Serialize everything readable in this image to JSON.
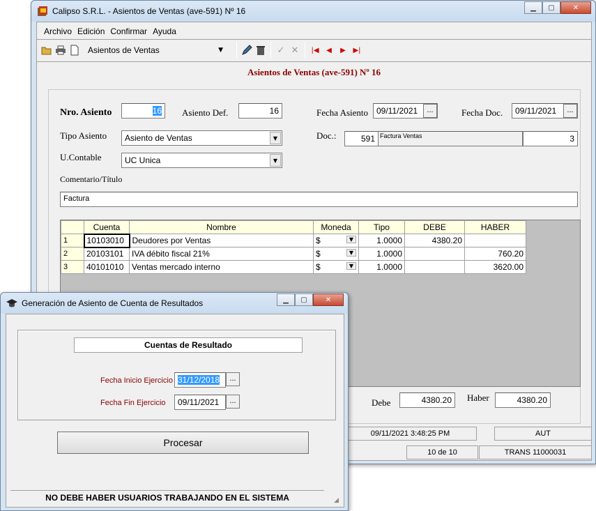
{
  "main": {
    "window_title": "Calipso S.R.L.  -  Asientos de Ventas (ave-591) Nº 16",
    "menu": [
      "Archivo",
      "Edición",
      "Confirmar",
      "Ayuda"
    ],
    "toolbar_combo": "Asientos de Ventas",
    "heading": "Asientos de Ventas (ave-591) Nº 16",
    "nro_asiento_label": "Nro. Asiento",
    "nro_asiento": "16",
    "asiento_def_label": "Asiento Def.",
    "asiento_def": "16",
    "fecha_asiento_label": "Fecha Asiento",
    "fecha_asiento": "09/11/2021",
    "fecha_doc_label": "Fecha Doc.",
    "fecha_doc": "09/11/2021",
    "tipo_asiento_label": "Tipo Asiento",
    "tipo_asiento": "Asiento de Ventas",
    "doc_label": "Doc.:",
    "doc_num": "591",
    "doc_desc": "Factura Ventas",
    "doc_extra": "3",
    "ucontable_label": "U.Contable",
    "ucontable": "UC Unica",
    "comentario_label": "Comentario/Título",
    "comentario": "Factura",
    "grid": {
      "headers": [
        "Cuenta",
        "Nombre",
        "Moneda",
        "Tipo",
        "DEBE",
        "HABER"
      ],
      "rows": [
        {
          "n": "1",
          "cuenta": "10103010",
          "nombre": "Deudores por Ventas",
          "moneda": "$",
          "tipo": "1.0000",
          "debe": "4380.20",
          "haber": ""
        },
        {
          "n": "2",
          "cuenta": "20103101",
          "nombre": "IVA débito fiscal 21%",
          "moneda": "$",
          "tipo": "1.0000",
          "debe": "",
          "haber": "760.20"
        },
        {
          "n": "3",
          "cuenta": "40101010",
          "nombre": "Ventas mercado interno",
          "moneda": "$",
          "tipo": "1.0000",
          "debe": "",
          "haber": "3620.00"
        }
      ]
    },
    "debe_label": "Debe",
    "debe_total": "4380.20",
    "haber_label": "Haber",
    "haber_total": "4380.20",
    "status_datetime": "09/11/2021 3:48:25 PM",
    "status_aut": "AUT",
    "status_page": "10 de 10",
    "status_trans": "TRANS 11000031"
  },
  "dialog": {
    "title": "Generación de Asiento de Cuenta de Resultados",
    "box_title": "Cuentas de Resultado",
    "fecha_inicio_label": "Fecha Inicio Ejercicio",
    "fecha_inicio": "31/12/2018",
    "fecha_fin_label": "Fecha Fin Ejercicio",
    "fecha_fin": "09/11/2021",
    "procesar_label": "Procesar",
    "warning": "NO DEBE HABER USUARIOS TRABAJANDO EN EL SISTEMA"
  },
  "colors": {
    "accent_red": "#8b0000",
    "grid_header": "#ffffe1",
    "selection": "#3399ff"
  }
}
